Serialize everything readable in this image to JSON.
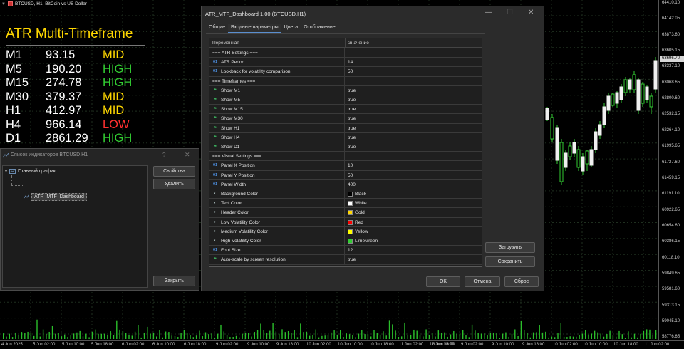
{
  "chart": {
    "header_text": "BTCUSD, H1:  BitCoin vs US Dollar",
    "current_price": "63696.70",
    "price_labels": [
      "64410.10",
      "64142.05",
      "63873.60",
      "63605.15",
      "63337.10",
      "63068.65",
      "62800.60",
      "62532.15",
      "62264.10",
      "61995.65",
      "61727.60",
      "61459.15",
      "61191.10",
      "60922.65",
      "60654.60",
      "60386.15",
      "60118.10",
      "59849.65",
      "59581.60",
      "59313.15",
      "59045.10",
      "58776.65"
    ],
    "time_labels": [
      "4 Jun 2025",
      "5 Jun 02:00",
      "5 Jun 10:00",
      "5 Jun 18:00",
      "6 Jun 02:00",
      "6 Jun 10:00",
      "6 Jun 18:00",
      "9 Jun 02:00",
      "9 Jun 10:00",
      "9 Jun 18:00",
      "10 Jun 02:00",
      "10 Jun 10:00",
      "10 Jun 18:00",
      "11 Jun 02:00",
      "11 Jun 10:00"
    ],
    "time_labels_extra": [
      "8 Jun 18:00",
      "9 Jun 02:00",
      "9 Jun 10:00",
      "9 Jun 18:00",
      "10 Jun 02:00",
      "10 Jun 10:00",
      "10 Jun 18:00",
      "11 Jun 02:00",
      "11 Jun 10:00"
    ]
  },
  "atr_panel": {
    "title": "ATR Multi-Timeframe",
    "rows": [
      {
        "tf": "M1",
        "value": "93.15",
        "level": "MID",
        "color": "#ffd700"
      },
      {
        "tf": "M5",
        "value": "190.20",
        "level": "HIGH",
        "color": "#32cd32"
      },
      {
        "tf": "M15",
        "value": "274.78",
        "level": "HIGH",
        "color": "#32cd32"
      },
      {
        "tf": "M30",
        "value": "379.37",
        "level": "MID",
        "color": "#ffd700"
      },
      {
        "tf": "H1",
        "value": "412.97",
        "level": "MID",
        "color": "#ffd700"
      },
      {
        "tf": "H4",
        "value": "966.14",
        "level": "LOW",
        "color": "#ff3030"
      },
      {
        "tf": "D1",
        "value": "2861.29",
        "level": "HIGH",
        "color": "#32cd32"
      }
    ]
  },
  "indicator_window": {
    "title": "Список индикаторов BTCUSD,H1",
    "help": "?",
    "close": "✕",
    "tree_root": "Главный график",
    "tree_child": "ATR_MTF_Dashboard",
    "btn_properties": "Свойства",
    "btn_delete": "Удалить",
    "btn_close": "Закрыть"
  },
  "dialog": {
    "title": "ATR_MTF_Dashboard 1.00 (BTCUSD,H1)",
    "tabs": [
      "Общие",
      "Входные параметры",
      "Цвета",
      "Отображение"
    ],
    "active_tab": 1,
    "col_name": "Переменная",
    "col_value": "Значение",
    "rows": [
      {
        "icon": "",
        "name": "=== ATR Settings ===",
        "value": ""
      },
      {
        "icon": "01",
        "name": "ATR Period",
        "value": "14"
      },
      {
        "icon": "01",
        "name": "Lookback for volatility comparison",
        "value": "50"
      },
      {
        "icon": "",
        "name": "=== Timeframes ===",
        "value": ""
      },
      {
        "icon": "flag",
        "name": "Show M1",
        "value": "true"
      },
      {
        "icon": "flag",
        "name": "Show M5",
        "value": "true"
      },
      {
        "icon": "flag",
        "name": "Show M15",
        "value": "true"
      },
      {
        "icon": "flag",
        "name": "Show M30",
        "value": "true"
      },
      {
        "icon": "flag",
        "name": "Show H1",
        "value": "true"
      },
      {
        "icon": "flag",
        "name": "Show H4",
        "value": "true"
      },
      {
        "icon": "flag",
        "name": "Show D1",
        "value": "true"
      },
      {
        "icon": "",
        "name": "=== Visual Settings ===",
        "value": ""
      },
      {
        "icon": "01",
        "name": "Panel X Position",
        "value": "10"
      },
      {
        "icon": "01",
        "name": "Panel Y Position",
        "value": "50"
      },
      {
        "icon": "01",
        "name": "Panel Width",
        "value": "400"
      },
      {
        "icon": "pal",
        "name": "Background Color",
        "value": "Black",
        "swatch": "#000000"
      },
      {
        "icon": "pal",
        "name": "Text Color",
        "value": "White",
        "swatch": "#ffffff"
      },
      {
        "icon": "pal",
        "name": "Header Color",
        "value": "Gold",
        "swatch": "#ffd700"
      },
      {
        "icon": "pal",
        "name": "Low Volatility Color",
        "value": "Red",
        "swatch": "#ff0000"
      },
      {
        "icon": "pal",
        "name": "Medium Volatility Color",
        "value": "Yellow",
        "swatch": "#ffff00"
      },
      {
        "icon": "pal",
        "name": "High Volatility Color",
        "value": "LimeGreen",
        "swatch": "#32cd32"
      },
      {
        "icon": "01",
        "name": "Font Size",
        "value": "12"
      },
      {
        "icon": "flag",
        "name": "Auto-scale by screen resolution",
        "value": "true"
      }
    ],
    "btn_load": "Загрузить",
    "btn_save": "Сохранить",
    "btn_ok": "OK",
    "btn_cancel": "Отмена",
    "btn_reset": "Сброс"
  }
}
